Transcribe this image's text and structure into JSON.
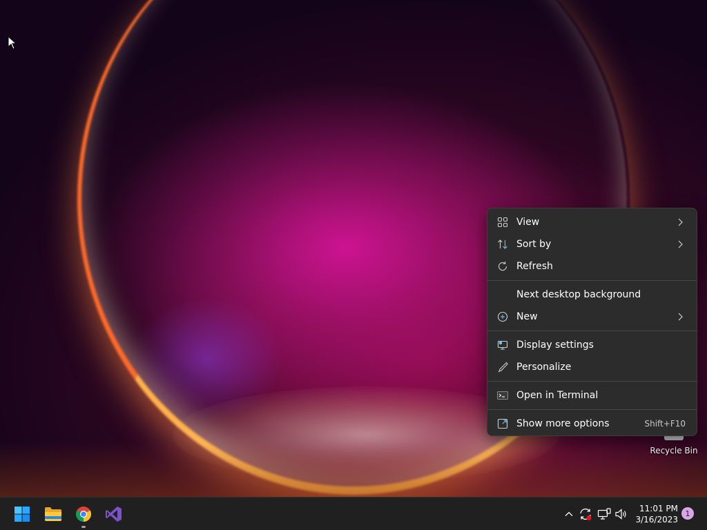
{
  "desktop": {
    "recycle_bin_label": "Recycle Bin"
  },
  "context_menu": {
    "items": [
      {
        "label": "View",
        "icon": "grid-icon",
        "has_submenu": true
      },
      {
        "label": "Sort by",
        "icon": "sort-icon",
        "has_submenu": true
      },
      {
        "label": "Refresh",
        "icon": "refresh-icon",
        "has_submenu": false
      },
      {
        "label": "Next desktop background",
        "icon": "",
        "has_submenu": false
      },
      {
        "label": "New",
        "icon": "plus-circle-icon",
        "has_submenu": true
      },
      {
        "label": "Display settings",
        "icon": "display-icon",
        "has_submenu": false
      },
      {
        "label": "Personalize",
        "icon": "brush-icon",
        "has_submenu": false
      },
      {
        "label": "Open in Terminal",
        "icon": "terminal-icon",
        "has_submenu": false
      },
      {
        "label": "Show more options",
        "icon": "expand-icon",
        "shortcut": "Shift+F10"
      }
    ]
  },
  "taskbar": {
    "apps": [
      {
        "name": "start",
        "icon": "windows-logo-icon"
      },
      {
        "name": "file-explorer",
        "icon": "folder-icon"
      },
      {
        "name": "chrome",
        "icon": "chrome-icon",
        "running": true
      },
      {
        "name": "visual-studio",
        "icon": "visual-studio-icon"
      }
    ],
    "tray": {
      "time": "11:01 PM",
      "date": "3/16/2023",
      "notification_count": "1"
    }
  },
  "colors": {
    "menu_bg": "#2c2c2c",
    "taskbar_bg": "#202020",
    "accent": "#60cdff"
  }
}
